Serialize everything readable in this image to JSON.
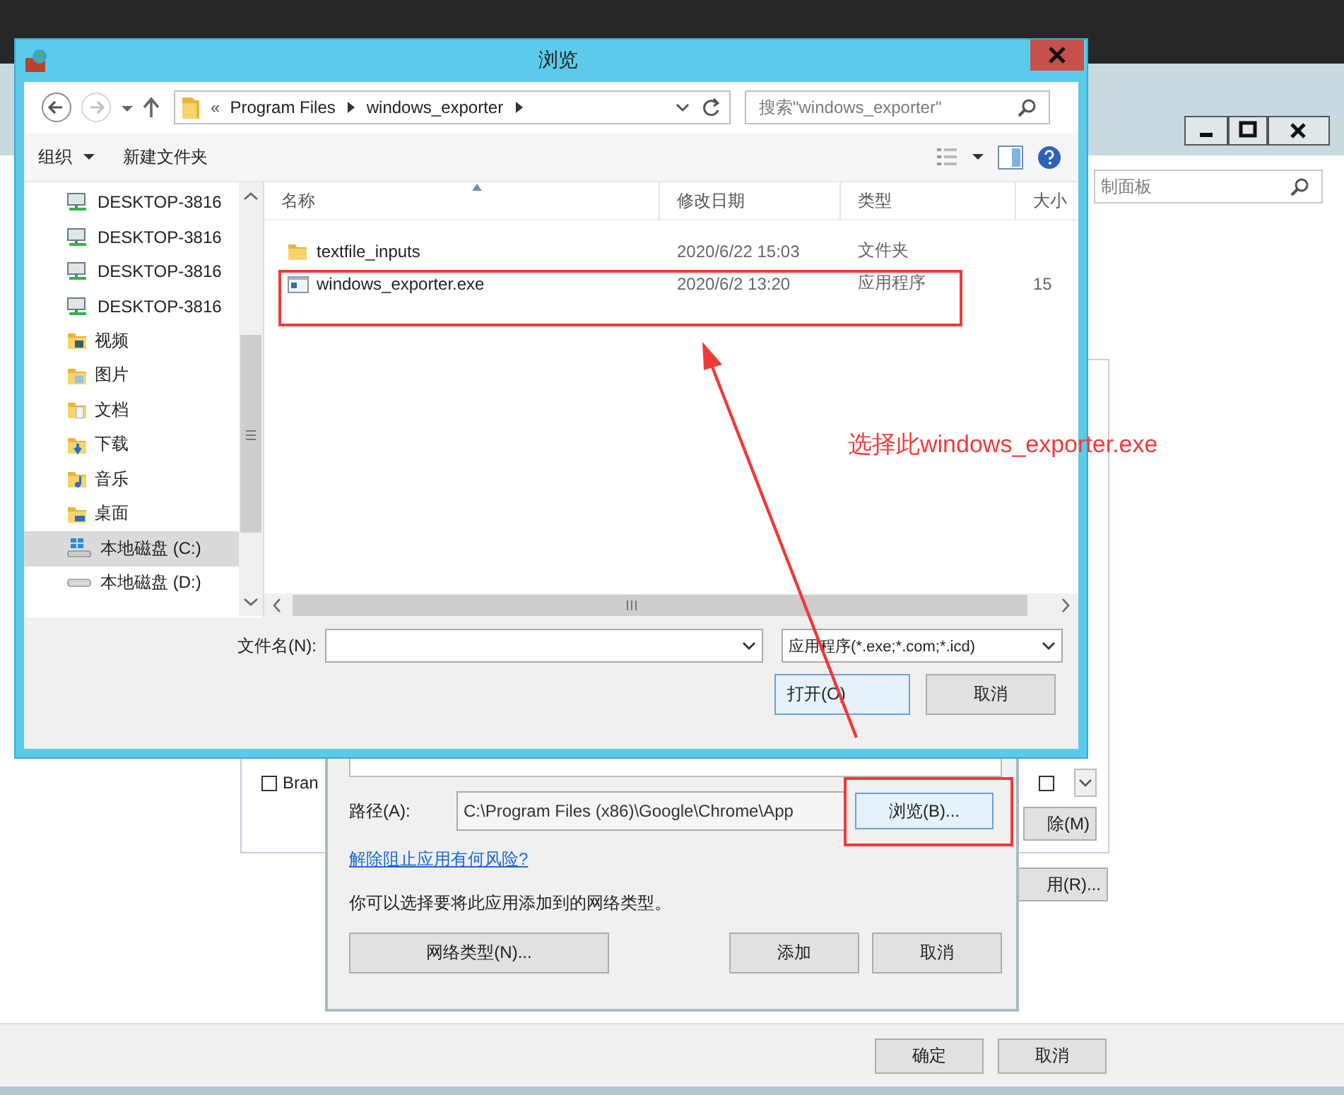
{
  "background_window": {
    "search": {
      "placeholder": "制面板"
    },
    "rows": [
      {
        "label": "Bran",
        "checked": false,
        "second_checked": false
      }
    ],
    "side_buttons": [
      "除(M)",
      "用(R)..."
    ],
    "footer_buttons": [
      "确定",
      "取消"
    ]
  },
  "add_app_dialog": {
    "path_label": "路径(A):",
    "path_value": "C:\\Program Files (x86)\\Google\\Chrome\\App",
    "browse_button": "浏览(B)...",
    "risk_link": "解除阻止应用有何风险?",
    "hint": "你可以选择要将此应用添加到的网络类型。",
    "network_button": "网络类型(N)...",
    "buttons": [
      "添加",
      "取消"
    ]
  },
  "browse_dialog": {
    "title": "浏览",
    "forward_disabled": true,
    "breadcrumb_prefix": "«",
    "breadcrumb": [
      "Program Files",
      "windows_exporter"
    ],
    "search": {
      "placeholder": "搜索\"windows_exporter\""
    },
    "toolbar": {
      "organize": "组织",
      "new_folder": "新建文件夹"
    },
    "nav_items": [
      {
        "label": "DESKTOP-3816",
        "kind": "network",
        "selected": false
      },
      {
        "label": "DESKTOP-3816",
        "kind": "network",
        "selected": false
      },
      {
        "label": "DESKTOP-3816",
        "kind": "network",
        "selected": false
      },
      {
        "label": "DESKTOP-3816",
        "kind": "network",
        "selected": false
      },
      {
        "label": "视频",
        "kind": "video",
        "selected": false
      },
      {
        "label": "图片",
        "kind": "pictures",
        "selected": false
      },
      {
        "label": "文档",
        "kind": "documents",
        "selected": false
      },
      {
        "label": "下载",
        "kind": "downloads",
        "selected": false
      },
      {
        "label": "音乐",
        "kind": "music",
        "selected": false
      },
      {
        "label": "桌面",
        "kind": "desktop",
        "selected": false
      },
      {
        "label": "本地磁盘 (C:)",
        "kind": "system-drive",
        "selected": true
      },
      {
        "label": "本地磁盘 (D:)",
        "kind": "drive",
        "selected": false
      }
    ],
    "columns": [
      "名称",
      "修改日期",
      "类型",
      "大小"
    ],
    "files": [
      {
        "name": "textfile_inputs",
        "modified": "2020/6/22 15:03",
        "type": "文件夹",
        "kind": "folder",
        "selected": false
      },
      {
        "name": "windows_exporter.exe",
        "modified": "2020/6/2 13:20",
        "type": "应用程序",
        "size": "15",
        "kind": "app",
        "selected": false
      }
    ],
    "filename_label": "文件名(N):",
    "filter": "应用程序(*.exe;*.com;*.icd)",
    "buttons": [
      "打开(O)",
      "取消"
    ]
  },
  "annotation": {
    "note": "选择此windows_exporter.exe"
  }
}
